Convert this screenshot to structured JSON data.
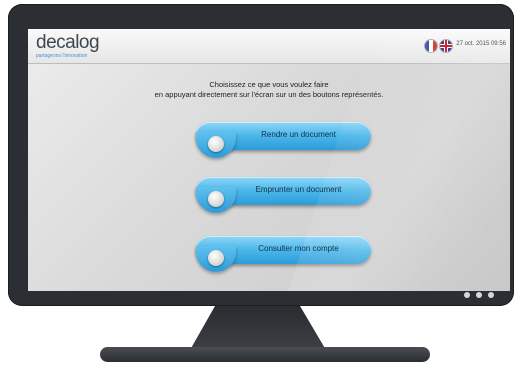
{
  "app": {
    "logo": "decalog",
    "tagline": "partageons l'innovation"
  },
  "header": {
    "datetime": "27 oct. 2015 09:56",
    "languages": [
      {
        "name": "french-flag-icon"
      },
      {
        "name": "uk-flag-icon"
      }
    ]
  },
  "instructions": {
    "line1": "Choisissez ce que vous voulez faire",
    "line2": "en appuyant directement sur l'écran sur un des boutons représentés."
  },
  "actions": [
    {
      "label": "Rendre un document"
    },
    {
      "label": "Emprunter un document"
    },
    {
      "label": "Consulter mon compte"
    }
  ],
  "colors": {
    "button_accent": "#4ab6ea",
    "monitor_frame": "#2b2e33"
  }
}
